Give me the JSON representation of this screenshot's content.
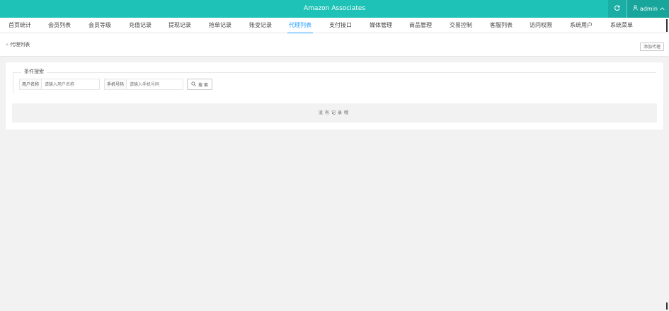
{
  "header": {
    "title": "Amazon Associates",
    "refresh_icon": "refresh-icon",
    "user_icon": "user-icon",
    "user_label": "admin",
    "caret_icon": "chevron-up-icon"
  },
  "colors": {
    "topbar": "#1fc2b7",
    "active_tab": "#1e9fff"
  },
  "nav": {
    "items": [
      {
        "label": "首页统计"
      },
      {
        "label": "会员列表"
      },
      {
        "label": "会员等级"
      },
      {
        "label": "充值记录"
      },
      {
        "label": "提现记录"
      },
      {
        "label": "抢单记录"
      },
      {
        "label": "账变记录"
      },
      {
        "label": "代理列表"
      },
      {
        "label": "支付接口"
      },
      {
        "label": "媒体管理"
      },
      {
        "label": "商品管理"
      },
      {
        "label": "交易控制"
      },
      {
        "label": "客服列表"
      },
      {
        "label": "访问权限"
      },
      {
        "label": "系统用户"
      },
      {
        "label": "系统菜单"
      }
    ],
    "active_label": "代理列表"
  },
  "subbar": {
    "breadcrumb": "代理列表",
    "add_button": "添加代理"
  },
  "search": {
    "legend": "条件搜索",
    "username_label": "用户名称",
    "username_placeholder": "请输入用户名称",
    "phone_label": "手机号码",
    "phone_placeholder": "请输入手机号码",
    "search_button": "搜 索",
    "search_icon": "search-icon"
  },
  "table": {
    "empty_text": "没有记录哦"
  }
}
